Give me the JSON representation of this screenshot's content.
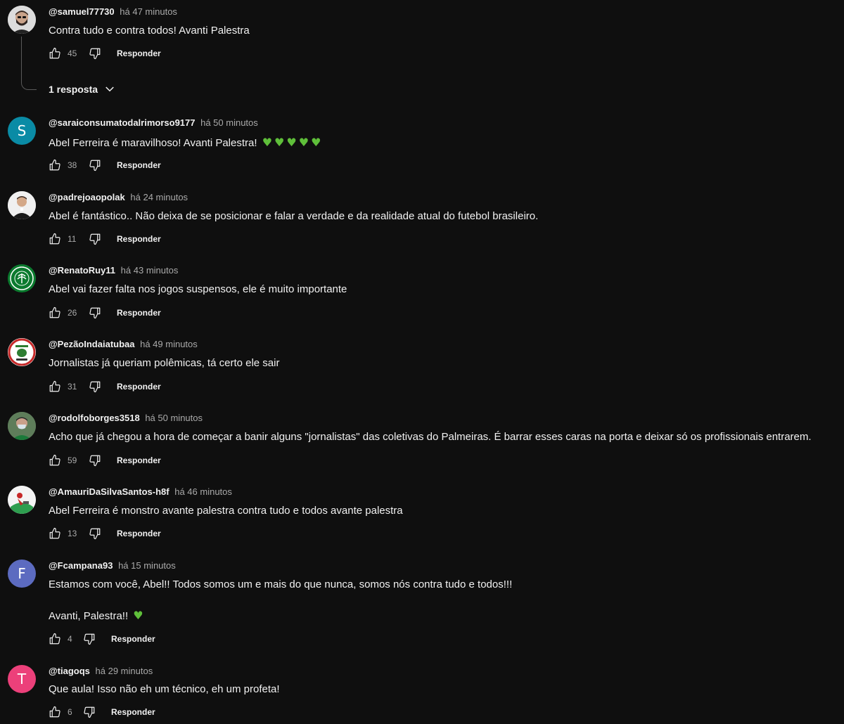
{
  "labels": {
    "reply": "Responder"
  },
  "comments": [
    {
      "author": "@samuel77730",
      "time": "há 47 minutos",
      "lines": [
        "Contra tudo e contra todos! Avanti Palestra"
      ],
      "hearts": 0,
      "likes": "45",
      "avatar": "photo-man-beard",
      "replies": "1 resposta"
    },
    {
      "author": "@saraiconsumatodalrimorso9177",
      "time": "há 50 minutos",
      "lines": [
        "Abel Ferreira é maravilhoso! Avanti Palestra! "
      ],
      "hearts": 5,
      "likes": "38",
      "avatar_letter": "S",
      "avatar_color": "#0a8ba5"
    },
    {
      "author": "@padrejoaopolak",
      "time": "há 24 minutos",
      "lines": [
        "Abel é fantástico.. Não deixa de se posicionar e falar a verdade e da realidade atual do futebol brasileiro."
      ],
      "hearts": 0,
      "likes": "11",
      "avatar": "photo-priest"
    },
    {
      "author": "@RenatoRuy11",
      "time": "há 43 minutos",
      "lines": [
        "Abel vai fazer falta nos jogos suspensos, ele é muito importante"
      ],
      "hearts": 0,
      "likes": "26",
      "avatar": "palmeiras-logo"
    },
    {
      "author": "@PezãoIndaiatubaa",
      "time": "há 49 minutos",
      "lines": [
        "Jornalistas já queriam polêmicas, tá certo ele sair"
      ],
      "hearts": 0,
      "likes": "31",
      "avatar": "badge-logo"
    },
    {
      "author": "@rodolfoborges3518",
      "time": "há 50 minutos",
      "lines": [
        "Acho que já chegou a hora de começar a banir alguns \"jornalistas\" das coletivas do Palmeiras. É barrar esses caras na porta e deixar só os profissionais entrarem."
      ],
      "hearts": 0,
      "likes": "59",
      "avatar": "photo-masked-man"
    },
    {
      "author": "@AmauriDaSilvaSantos-h8f",
      "time": "há 46 minutos",
      "lines": [
        "Abel Ferreira é monstro avante palestra contra tudo e todos avante palestra"
      ],
      "hearts": 0,
      "likes": "13",
      "avatar": "illustration-green"
    },
    {
      "author": "@Fcampana93",
      "time": "há 15 minutos",
      "lines": [
        "Estamos com você, Abel!! Todos somos um e mais do que nunca, somos nós contra tudo e todos!!!",
        "Avanti, Palestra!! "
      ],
      "hearts": 1,
      "likes": "4",
      "avatar_letter": "F",
      "avatar_color": "#5c6bc0"
    },
    {
      "author": "@tiagoqs",
      "time": "há 29 minutos",
      "lines": [
        "Que aula! Isso não eh um técnico, eh um profeta!"
      ],
      "hearts": 0,
      "likes": "6",
      "avatar_letter": "T",
      "avatar_color": "#ec407a"
    }
  ]
}
